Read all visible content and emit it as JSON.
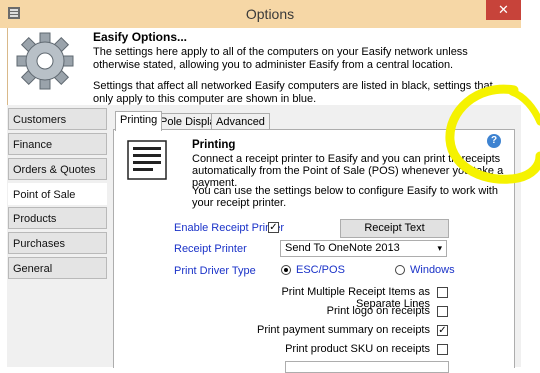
{
  "window": {
    "title": "Options",
    "close_glyph": "✕"
  },
  "header": {
    "title": "Easify Options...",
    "line1": "The settings here apply to all of the computers on your Easify network unless otherwise stated, allowing you to administer Easify from a central location.",
    "line2": "Settings that affect all networked Easify computers are listed in black, settings that only apply to this computer are shown in blue."
  },
  "sidebar": {
    "items": [
      {
        "label": "Customers"
      },
      {
        "label": "Finance"
      },
      {
        "label": "Orders & Quotes"
      },
      {
        "label": "Point of Sale"
      },
      {
        "label": "Products"
      },
      {
        "label": "Purchases"
      },
      {
        "label": "General"
      }
    ],
    "active": "Point of Sale"
  },
  "tabs": [
    {
      "label": "Printing"
    },
    {
      "label": "Pole Display"
    },
    {
      "label": "Advanced"
    }
  ],
  "active_tab": "Printing",
  "printing": {
    "title": "Printing",
    "desc1": "Connect a receipt printer to Easify and you can print till receipts automatically from the Point of Sale (POS) whenever you take a payment.",
    "desc2": "You can use the settings below to configure Easify to work with your receipt printer.",
    "help_glyph": "?",
    "enable_label": "Enable Receipt Printer",
    "enable_checked": true,
    "receipt_text_button": "Receipt Text",
    "receipt_printer_label": "Receipt Printer",
    "receipt_printer_value": "Send To OneNote 2013",
    "driver_type_label": "Print Driver Type",
    "driver_options": [
      {
        "label": "ESC/POS",
        "selected": true
      },
      {
        "label": "Windows",
        "selected": false
      }
    ],
    "options": [
      {
        "label": "Print Multiple Receipt Items as Separate Lines",
        "checked": false
      },
      {
        "label": "Print logo on receipts",
        "checked": false
      },
      {
        "label": "Print payment summary on receipts",
        "checked": true
      },
      {
        "label": "Print product SKU on receipts",
        "checked": false
      }
    ],
    "check_glyph": "✓",
    "dropdown_glyph": "▾"
  },
  "colors": {
    "accent_blue": "#1a32c8",
    "titlebar": "#f6d7a6",
    "close": "#c7433a",
    "highlight": "#f5f200"
  },
  "icons": [
    "gear-icon",
    "printer-icon",
    "help-icon",
    "app-icon",
    "close-icon"
  ]
}
